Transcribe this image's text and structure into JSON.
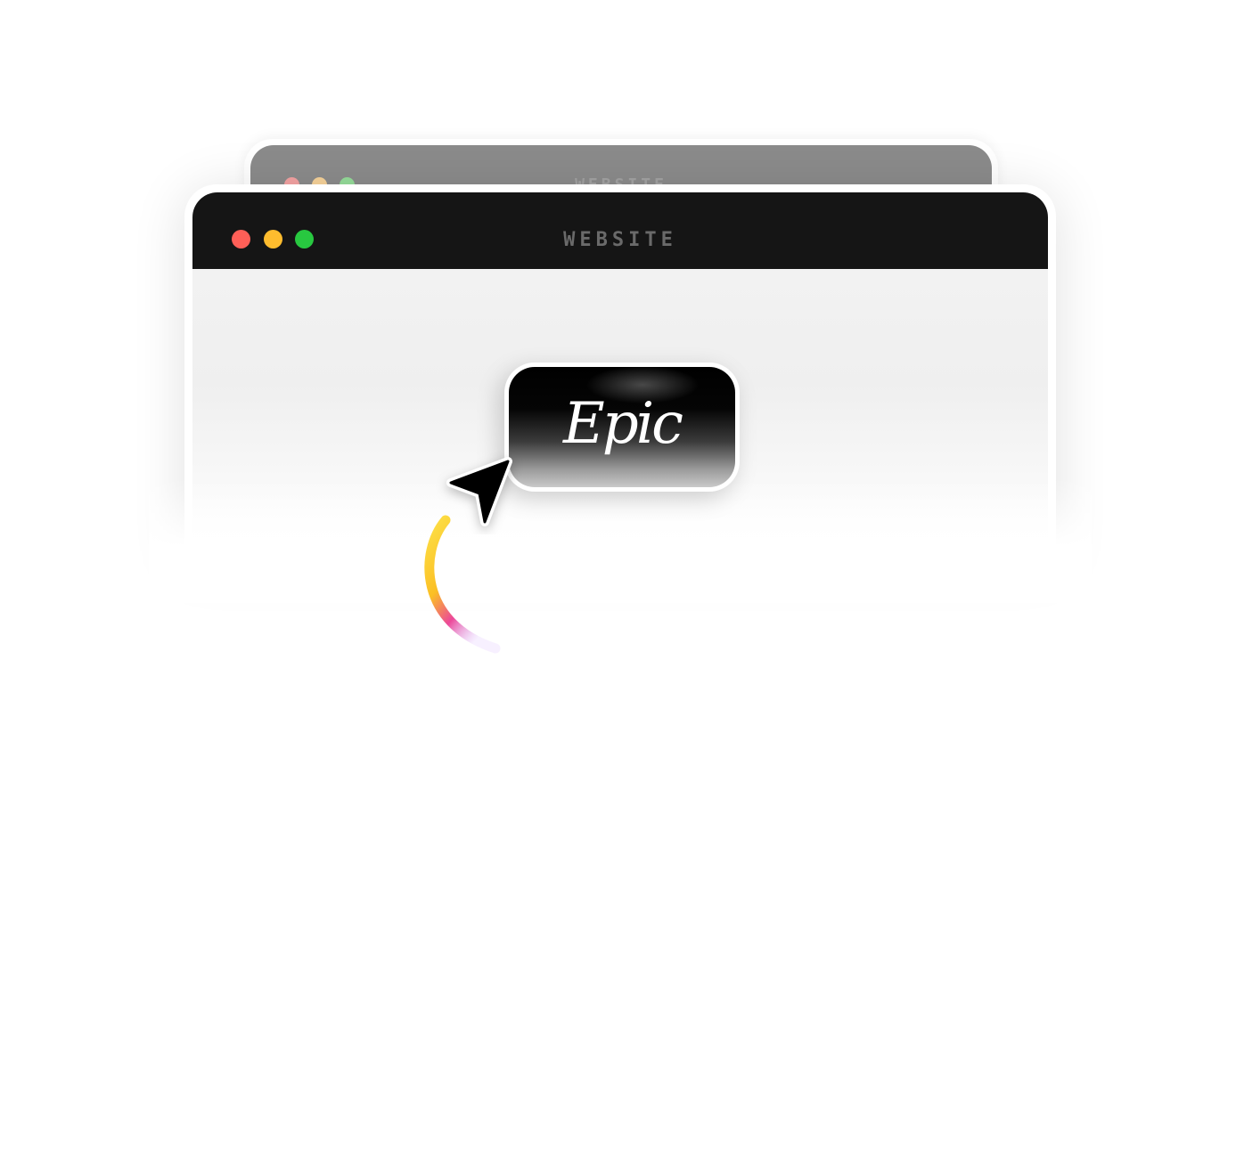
{
  "back_window": {
    "title": "WEBSITE",
    "traffic_lights": [
      {
        "name": "close",
        "color": "#f4a3a3"
      },
      {
        "name": "minimize",
        "color": "#f7d39a"
      },
      {
        "name": "maximize",
        "color": "#95dc9a"
      }
    ]
  },
  "front_window": {
    "title": "WEBSITE",
    "traffic_lights": [
      {
        "name": "close",
        "color": "#ff5f57"
      },
      {
        "name": "minimize",
        "color": "#febc2e"
      },
      {
        "name": "maximize",
        "color": "#28c840"
      }
    ]
  },
  "epic_button": {
    "label": "Epic"
  },
  "cursor": {
    "icon": "pointer-arrow-icon"
  },
  "motion_arc": {
    "colors": [
      "#fde047",
      "#ec4899",
      "#d8b4fe"
    ]
  }
}
